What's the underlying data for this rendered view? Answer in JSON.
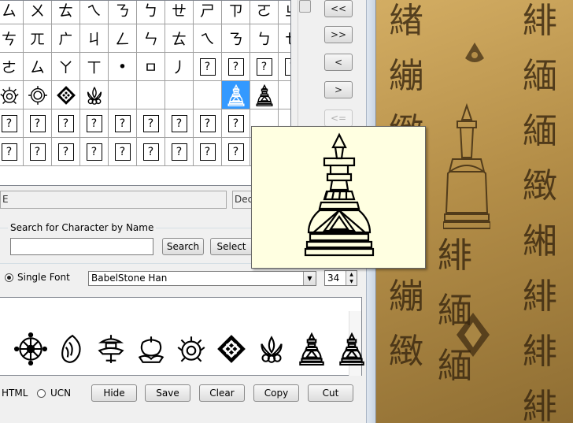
{
  "grid": {
    "rows": [
      [
        "ㄙ",
        "ㄨ",
        "ㄊ",
        "ㄟ",
        "ㄋ",
        "ㄅ",
        "ㄝ",
        "ㄕ",
        "ㄗ",
        "ㄛ",
        "ㄓ"
      ],
      [
        "ㄘ",
        "ㄫ",
        "ㄬ",
        "ㄐ",
        "ㄥ",
        "ㄣ",
        "ㄊ",
        "ㄟ",
        "ㄋ",
        "ㄅ",
        "ㄝ"
      ],
      [
        "ㄜ",
        "ㄙ",
        "ㄚ",
        "ㄒ",
        "•",
        "ㅁ",
        "丿",
        "?",
        "?",
        "?",
        "?"
      ],
      [
        "",
        "",
        "",
        "",
        "",
        "",
        "",
        "",
        "",
        "",
        ""
      ],
      [
        "?",
        "?",
        "?",
        "?",
        "?",
        "?",
        "?",
        "?",
        "?",
        "",
        ""
      ],
      [
        "?",
        "?",
        "?",
        "?",
        "?",
        "?",
        "?",
        "?",
        "?",
        "",
        ""
      ]
    ],
    "symbol_row_icons": [
      "lotus-icon",
      "wreath-icon",
      "endless-knot-icon",
      "lotus-flower-icon",
      "",
      "",
      "",
      "",
      "stupa-icon",
      "stupa-small-icon",
      ""
    ],
    "selected_icon": "stupa-icon"
  },
  "nav": {
    "first": "<<",
    "last": ">>",
    "prev": "<",
    "next": ">",
    "back": "<="
  },
  "info": {
    "codepoint_partial": "E",
    "decimal_partial": "Deci"
  },
  "search": {
    "legend": "Search for Character by Name",
    "value": "",
    "search_label": "Search",
    "select_label": "Select"
  },
  "font": {
    "mode_label": "Single Font",
    "name": "BabelStone Han",
    "size": "34"
  },
  "preview": {
    "icons": [
      "dharma-wheel-icon",
      "conch-shell-icon",
      "parasol-icon",
      "golden-fish-icon",
      "lotus-wreath-icon",
      "endless-knot-icon",
      "lotus-flower-icon",
      "stupa-icon",
      "stupa-small-icon"
    ]
  },
  "bottom": {
    "html_label": "HTML",
    "ucn_label": "UCN",
    "hide": "Hide",
    "save": "Save",
    "clear": "Clear",
    "copy": "Copy",
    "cut": "Cut"
  },
  "photo": {
    "columns": [
      [
        "緖",
        "繃",
        "緻",
        "緢",
        "繃",
        "繃",
        "緻"
      ],
      [
        "緋",
        "緬",
        "緬",
        "繖",
        "緬",
        "緜",
        "緻",
        "緻"
      ],
      [
        "緋",
        "緬",
        "緬",
        "緻",
        "緗",
        "緋",
        "緋",
        "緋"
      ]
    ]
  },
  "colors": {
    "selection": "#3399ff",
    "tooltip_bg": "#ffffe1",
    "photo_tone": "#b48e48"
  }
}
